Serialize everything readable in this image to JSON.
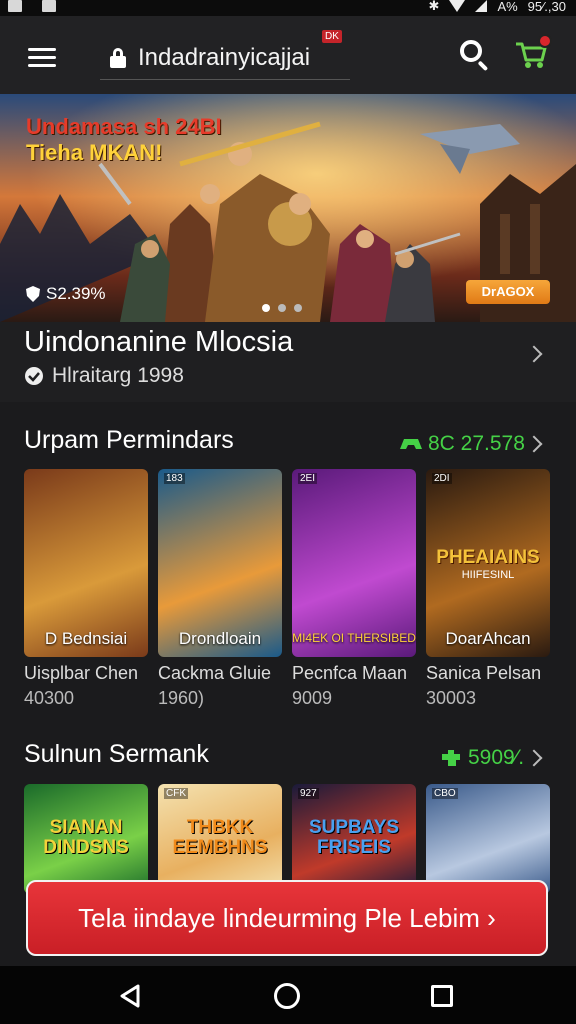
{
  "status_bar": {
    "bluetooth": "✱",
    "battery": "A%",
    "time": "95⁄.,30"
  },
  "browser": {
    "url": "Indadrainyicajjai",
    "url_badge": "DK"
  },
  "hero": {
    "title": "Undamasa sh 24BI",
    "subtitle": "Tieha MKAN!",
    "rating": "S2.39%",
    "button": "DrAGOX",
    "slide_count": 3,
    "active_slide": 1
  },
  "featured": {
    "title": "Uindonanine Mlocsia",
    "meta": "Hlraitarg 1998"
  },
  "section1": {
    "title": "Urpam Permindars",
    "link": "8C 27.578",
    "games": [
      {
        "tag": "",
        "label": "D Bednsiai",
        "name": "Uisplbar Chen",
        "num": "40300",
        "colors": [
          "#7a3a1a",
          "#d99a3a"
        ]
      },
      {
        "tag": "183",
        "label": "Drondloain",
        "name": "Cackma Gluie",
        "num": "1960)",
        "colors": [
          "#1a5a8a",
          "#e89a3a"
        ]
      },
      {
        "tag": "2EI",
        "label": "MI4EK OI THERSIBED",
        "name": "Pecnfca Maan",
        "num": "9009",
        "colors": [
          "#5a1a7a",
          "#c04ad0"
        ]
      },
      {
        "tag": "2DI",
        "label": "DoarAhcan",
        "name": "Sanica Pelsan",
        "num": "30003",
        "colors": [
          "#2a1a10",
          "#b06a20"
        ]
      }
    ],
    "card_art": [
      "PHEAIAINS",
      "HIIFESINL"
    ]
  },
  "section2": {
    "title": "Sulnun Sermank",
    "link": "5909⁄.",
    "games": [
      {
        "tag": "",
        "art": "SIANAN DINDSNS",
        "art_color": "#f4d23a",
        "colors": [
          "#1a6a2a",
          "#7ad048"
        ]
      },
      {
        "tag": "CFK",
        "art": "THBKK EEMBHNS",
        "art_color": "#f08a1a",
        "colors": [
          "#f4e2b0",
          "#e8b060"
        ]
      },
      {
        "tag": "927",
        "art": "SUPBAYS FRISEIS",
        "art_color": "#4aa0f0",
        "colors": [
          "#1a1a3a",
          "#c03a2a"
        ]
      },
      {
        "tag": "CBO",
        "art": "",
        "art_color": "#ffffff",
        "colors": [
          "#3a5a8a",
          "#b8c8e0"
        ]
      }
    ]
  },
  "cta": {
    "label": "Tela iindaye lindeurming Ple Lebim ›"
  },
  "colors": {
    "accent_green": "#45d146",
    "accent_red": "#d8262c",
    "background": "#1b1b1d"
  }
}
